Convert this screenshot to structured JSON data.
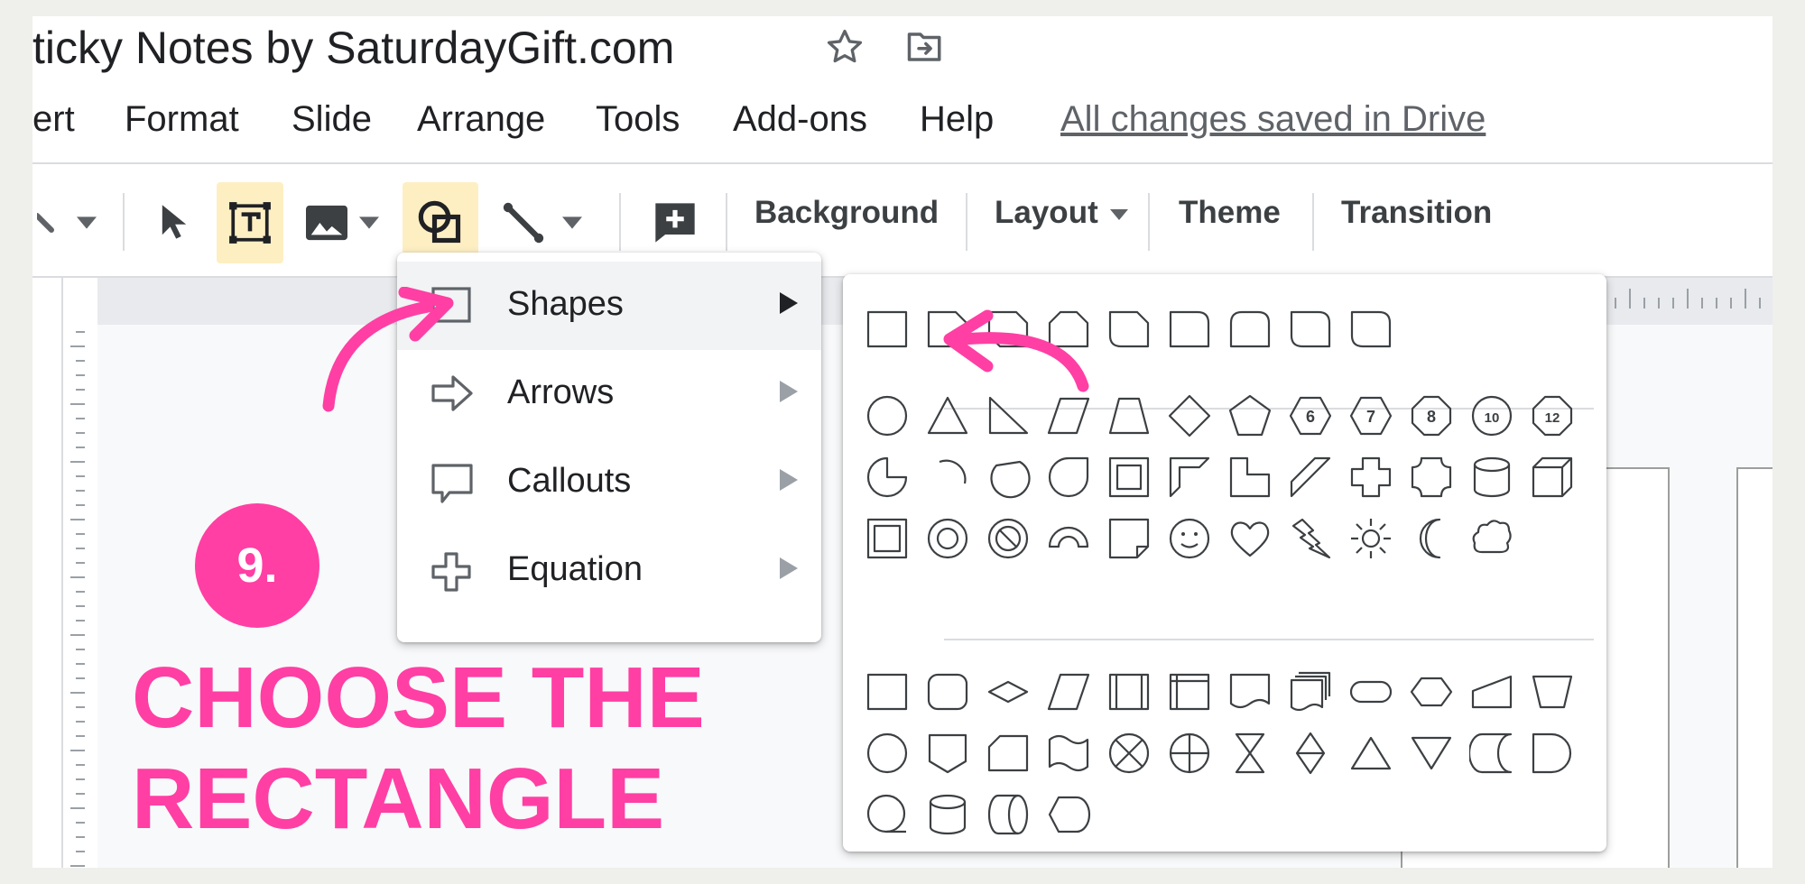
{
  "window": {
    "title": "ticky Notes by SaturdayGift.com"
  },
  "menu": {
    "items": [
      "ert",
      "Format",
      "Slide",
      "Arrange",
      "Tools",
      "Add-ons",
      "Help"
    ],
    "saved_status": "All changes saved in Drive"
  },
  "toolbar": {
    "background_label": "Background",
    "layout_label": "Layout",
    "theme_label": "Theme",
    "transition_label": "Transition",
    "active_tools": [
      "text-box",
      "shape"
    ]
  },
  "shape_menu": {
    "items": [
      {
        "label": "Shapes",
        "icon": "rectangle-icon",
        "highlighted": true
      },
      {
        "label": "Arrows",
        "icon": "arrow-outline-icon",
        "highlighted": false
      },
      {
        "label": "Callouts",
        "icon": "callout-icon",
        "highlighted": false
      },
      {
        "label": "Equation",
        "icon": "plus-outline-icon",
        "highlighted": false
      }
    ]
  },
  "shape_palette": {
    "labels": [
      "6",
      "7",
      "8",
      "10",
      "12"
    ]
  },
  "annotation": {
    "step": "9.",
    "caption_line1": "CHOOSE THE",
    "caption_line2": "RECTANGLE",
    "accent_color": "#ff3fa4"
  },
  "colors": {
    "active_tool_bg": "#feefc3",
    "menu_highlight": "#f1f3f4",
    "text": "#202124",
    "status_text": "#5f6368"
  }
}
